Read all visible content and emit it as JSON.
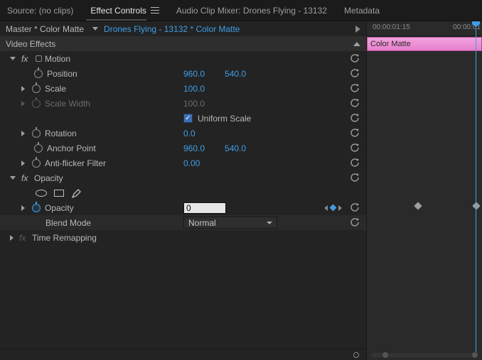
{
  "tabs": {
    "source": "Source: (no clips)",
    "effect_controls": "Effect Controls",
    "mixer": "Audio Clip Mixer: Drones Flying - 13132",
    "metadata": "Metadata"
  },
  "seq": {
    "master": "Master * Color Matte",
    "clip": "Drones Flying - 13132 * Color Matte"
  },
  "sections": {
    "video_effects": "Video Effects"
  },
  "motion": {
    "title": "Motion",
    "position": {
      "label": "Position",
      "x": "960.0",
      "y": "540.0"
    },
    "scale": {
      "label": "Scale",
      "v": "100.0"
    },
    "scale_width": {
      "label": "Scale Width",
      "v": "100.0"
    },
    "uniform": {
      "label": "Uniform Scale"
    },
    "rotation": {
      "label": "Rotation",
      "v": "0.0"
    },
    "anchor": {
      "label": "Anchor Point",
      "x": "960.0",
      "y": "540.0"
    },
    "flicker": {
      "label": "Anti-flicker Filter",
      "v": "0.00"
    }
  },
  "opacity": {
    "title": "Opacity",
    "opacity": {
      "label": "Opacity",
      "v": "0"
    },
    "blend": {
      "label": "Blend Mode",
      "v": "Normal"
    }
  },
  "time_remap": {
    "title": "Time Remapping"
  },
  "timeline": {
    "tc1": "00:00:01:15",
    "tc2": "00:00:01",
    "clip_label": "Color Matte"
  }
}
